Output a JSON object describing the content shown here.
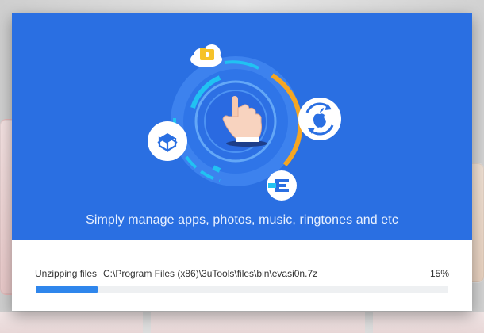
{
  "banner": {
    "tagline": "Simply manage apps, photos, music, ringtones and etc",
    "icons": [
      "cloud-folder-icon",
      "hand-pointer-icon",
      "dropbox-icon",
      "apple-sync-icon",
      "evasi0n-icon"
    ],
    "colors": {
      "background": "#2a6fe2",
      "accent_cyan": "#21c2f2",
      "accent_orange": "#f5a623"
    }
  },
  "progress": {
    "label": "Unzipping files",
    "path": "C:\\Program Files (x86)\\3uTools\\files\\bin\\evasi0n.7z",
    "percent_text": "15%",
    "fraction": 0.15,
    "colors": {
      "fill": "#2f86ec",
      "track": "#eef0f2"
    }
  }
}
